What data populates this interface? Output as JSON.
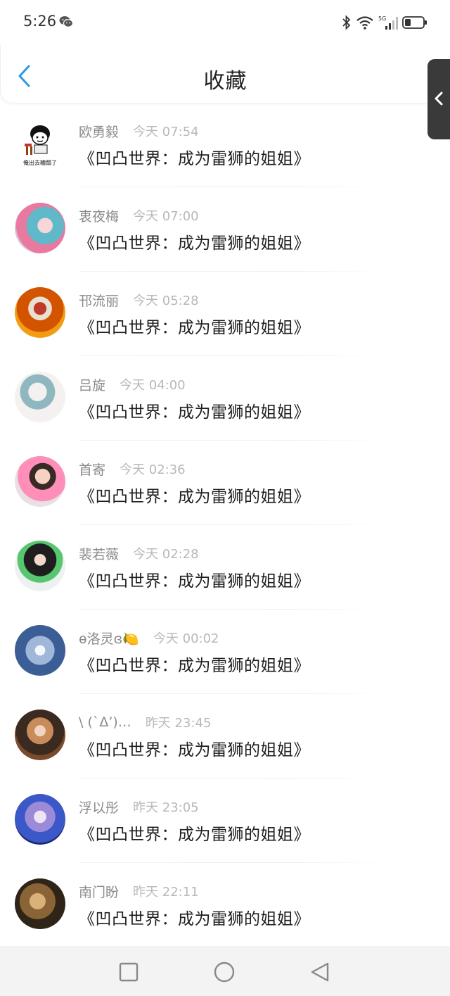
{
  "status_bar": {
    "time": "5:26",
    "icons": [
      "wechat-icon",
      "bluetooth-icon",
      "wifi-icon",
      "5g-signal-icon",
      "battery-icon"
    ]
  },
  "header": {
    "title": "收藏",
    "back_icon": "chevron-left-icon"
  },
  "side_handle": {
    "icon": "chevron-left-icon"
  },
  "items": [
    {
      "name": "欧勇毅",
      "time": "今天 07:54",
      "content": "《凹凸世界：成为雷狮的姐姐》"
    },
    {
      "name": "衷夜梅",
      "time": "今天 07:00",
      "content": "《凹凸世界：成为雷狮的姐姐》"
    },
    {
      "name": "邗流丽",
      "time": "今天 05:28",
      "content": "《凹凸世界：成为雷狮的姐姐》"
    },
    {
      "name": "吕旋",
      "time": "今天 04:00",
      "content": "《凹凸世界：成为雷狮的姐姐》"
    },
    {
      "name": "首寄",
      "time": "今天 02:36",
      "content": "《凹凸世界：成为雷狮的姐姐》"
    },
    {
      "name": "裴若薇",
      "time": "今天 02:28",
      "content": "《凹凸世界：成为雷狮的姐姐》"
    },
    {
      "name": "ɵ洛灵ɞ🍋",
      "time": "今天 00:02",
      "content": "《凹凸世界：成为雷狮的姐姐》"
    },
    {
      "name": "\\ (`Δ’)…",
      "time": "昨天 23:45",
      "content": "《凹凸世界：成为雷狮的姐姐》"
    },
    {
      "name": "浮以彤",
      "time": "昨天 23:05",
      "content": "《凹凸世界：成为雷狮的姐姐》"
    },
    {
      "name": "南门盼",
      "time": "昨天 22:11",
      "content": "《凹凸世界：成为雷狮的姐姐》"
    }
  ],
  "first_avatar_caption": "俺出去糟蹋了",
  "nav_bar": {
    "buttons": [
      "recent-apps-icon",
      "home-icon",
      "back-triangle-icon"
    ]
  }
}
